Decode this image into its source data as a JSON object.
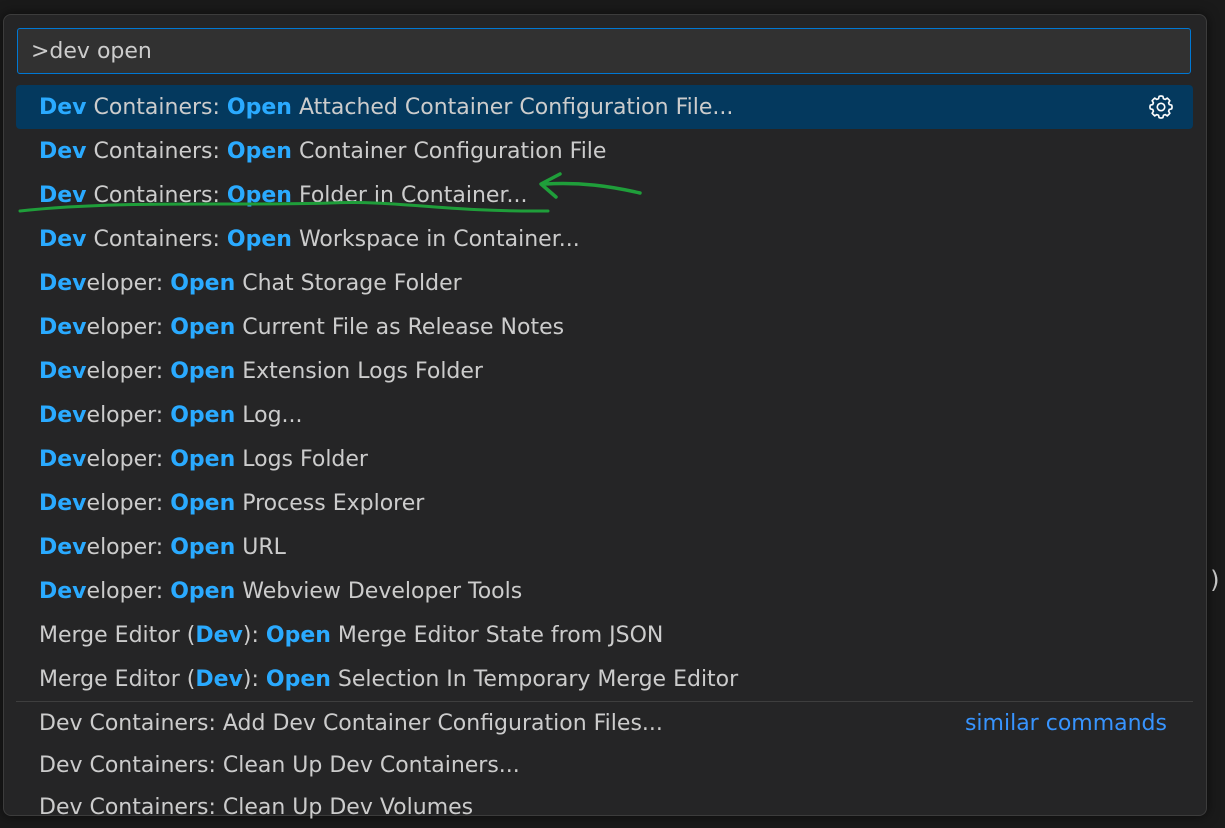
{
  "background_fragment": ")",
  "palette": {
    "query": ">dev open"
  },
  "results": [
    {
      "hl1": "Dev",
      "rest1": " Containers: ",
      "hl2": "Open",
      "rest2": " Attached Container Configuration File...",
      "selected": true
    },
    {
      "hl1": "Dev",
      "rest1": " Containers: ",
      "hl2": "Open",
      "rest2": " Container Configuration File"
    },
    {
      "hl1": "Dev",
      "rest1": " Containers: ",
      "hl2": "Open",
      "rest2": " Folder in Container..."
    },
    {
      "hl1": "Dev",
      "rest1": " Containers: ",
      "hl2": "Open",
      "rest2": " Workspace in Container..."
    },
    {
      "hl1": "Dev",
      "rest1": "eloper: ",
      "hl2": "Open",
      "rest2": " Chat Storage Folder"
    },
    {
      "hl1": "Dev",
      "rest1": "eloper: ",
      "hl2": "Open",
      "rest2": " Current File as Release Notes"
    },
    {
      "hl1": "Dev",
      "rest1": "eloper: ",
      "hl2": "Open",
      "rest2": " Extension Logs Folder"
    },
    {
      "hl1": "Dev",
      "rest1": "eloper: ",
      "hl2": "Open",
      "rest2": " Log..."
    },
    {
      "hl1": "Dev",
      "rest1": "eloper: ",
      "hl2": "Open",
      "rest2": " Logs Folder"
    },
    {
      "hl1": "Dev",
      "rest1": "eloper: ",
      "hl2": "Open",
      "rest2": " Process Explorer"
    },
    {
      "hl1": "Dev",
      "rest1": "eloper: ",
      "hl2": "Open",
      "rest2": " URL"
    },
    {
      "hl1": "Dev",
      "rest1": "eloper: ",
      "hl2": "Open",
      "rest2": " Webview Developer Tools"
    },
    {
      "pre": "Merge Editor (",
      "hl1": "Dev",
      "rest1": "): ",
      "hl2": "Open",
      "rest2": " Merge Editor State from JSON"
    },
    {
      "pre": "Merge Editor (",
      "hl1": "Dev",
      "rest1": "): ",
      "hl2": "Open",
      "rest2": " Selection In Temporary Merge Editor"
    }
  ],
  "similar": {
    "label": "similar commands",
    "items": [
      "Dev Containers: Add Dev Container Configuration Files...",
      "Dev Containers: Clean Up Dev Containers...",
      "Dev Containers: Clean Up Dev Volumes"
    ]
  },
  "icons": {
    "configure": "gear-icon"
  },
  "colors": {
    "highlight": "#2aaaff",
    "selected_row": "#04395e",
    "input_border": "#0078d4",
    "annotation": "#1f9e3a",
    "link": "#3794ff"
  }
}
